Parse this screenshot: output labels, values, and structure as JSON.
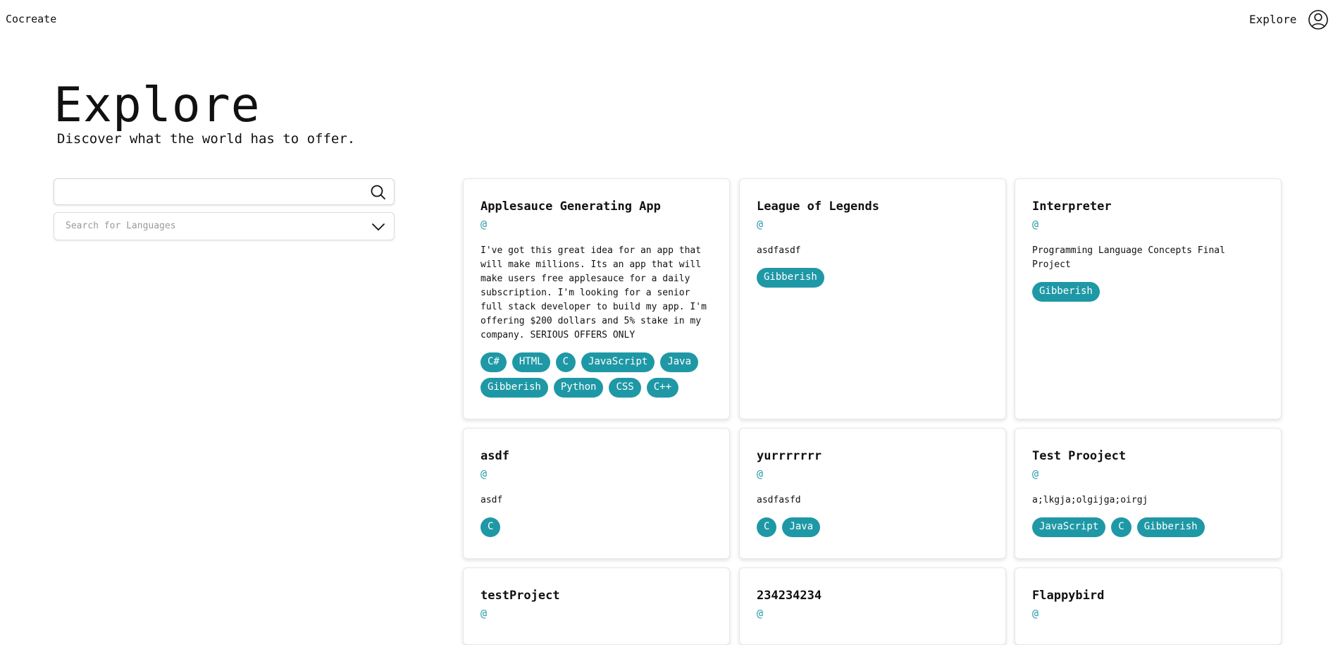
{
  "header": {
    "brand": "Cocreate",
    "nav_explore": "Explore"
  },
  "hero": {
    "title": "Explore",
    "subtitle": "Discover what the world has to offer."
  },
  "filters": {
    "search_value": "",
    "language_placeholder": "Search for Languages"
  },
  "projects": [
    {
      "title": "Applesauce Generating App",
      "owner": "@",
      "description": "I've got this great idea for an app that will make millions. Its an app that will make users free applesauce for a daily subscription. I'm looking for a senior full stack developer to build my app. I'm offering $200 dollars and 5% stake in my company. SERIOUS OFFERS ONLY",
      "tags": [
        "C#",
        "HTML",
        "C",
        "JavaScript",
        "Java",
        "Gibberish",
        "Python",
        "CSS",
        "C++"
      ]
    },
    {
      "title": "League of Legends",
      "owner": "@",
      "description": "asdfasdf",
      "tags": [
        "Gibberish"
      ]
    },
    {
      "title": "Interpreter",
      "owner": "@",
      "description": "Programming Language Concepts Final Project",
      "tags": [
        "Gibberish"
      ]
    },
    {
      "title": "asdf",
      "owner": "@",
      "description": "asdf",
      "tags": [
        "C"
      ]
    },
    {
      "title": "yurrrrrrr",
      "owner": "@",
      "description": "asdfasfd",
      "tags": [
        "C",
        "Java"
      ]
    },
    {
      "title": "Test Prooject",
      "owner": "@",
      "description": "a;lkgja;olgijga;oirgj",
      "tags": [
        "JavaScript",
        "C",
        "Gibberish"
      ]
    },
    {
      "title": "testProject",
      "owner": "@",
      "description": "",
      "tags": []
    },
    {
      "title": "234234234",
      "owner": "@",
      "description": "",
      "tags": []
    },
    {
      "title": "Flappybird",
      "owner": "@",
      "description": "",
      "tags": []
    }
  ],
  "colors": {
    "accent": "#1f98a6",
    "owner": "#2a9aa8"
  }
}
